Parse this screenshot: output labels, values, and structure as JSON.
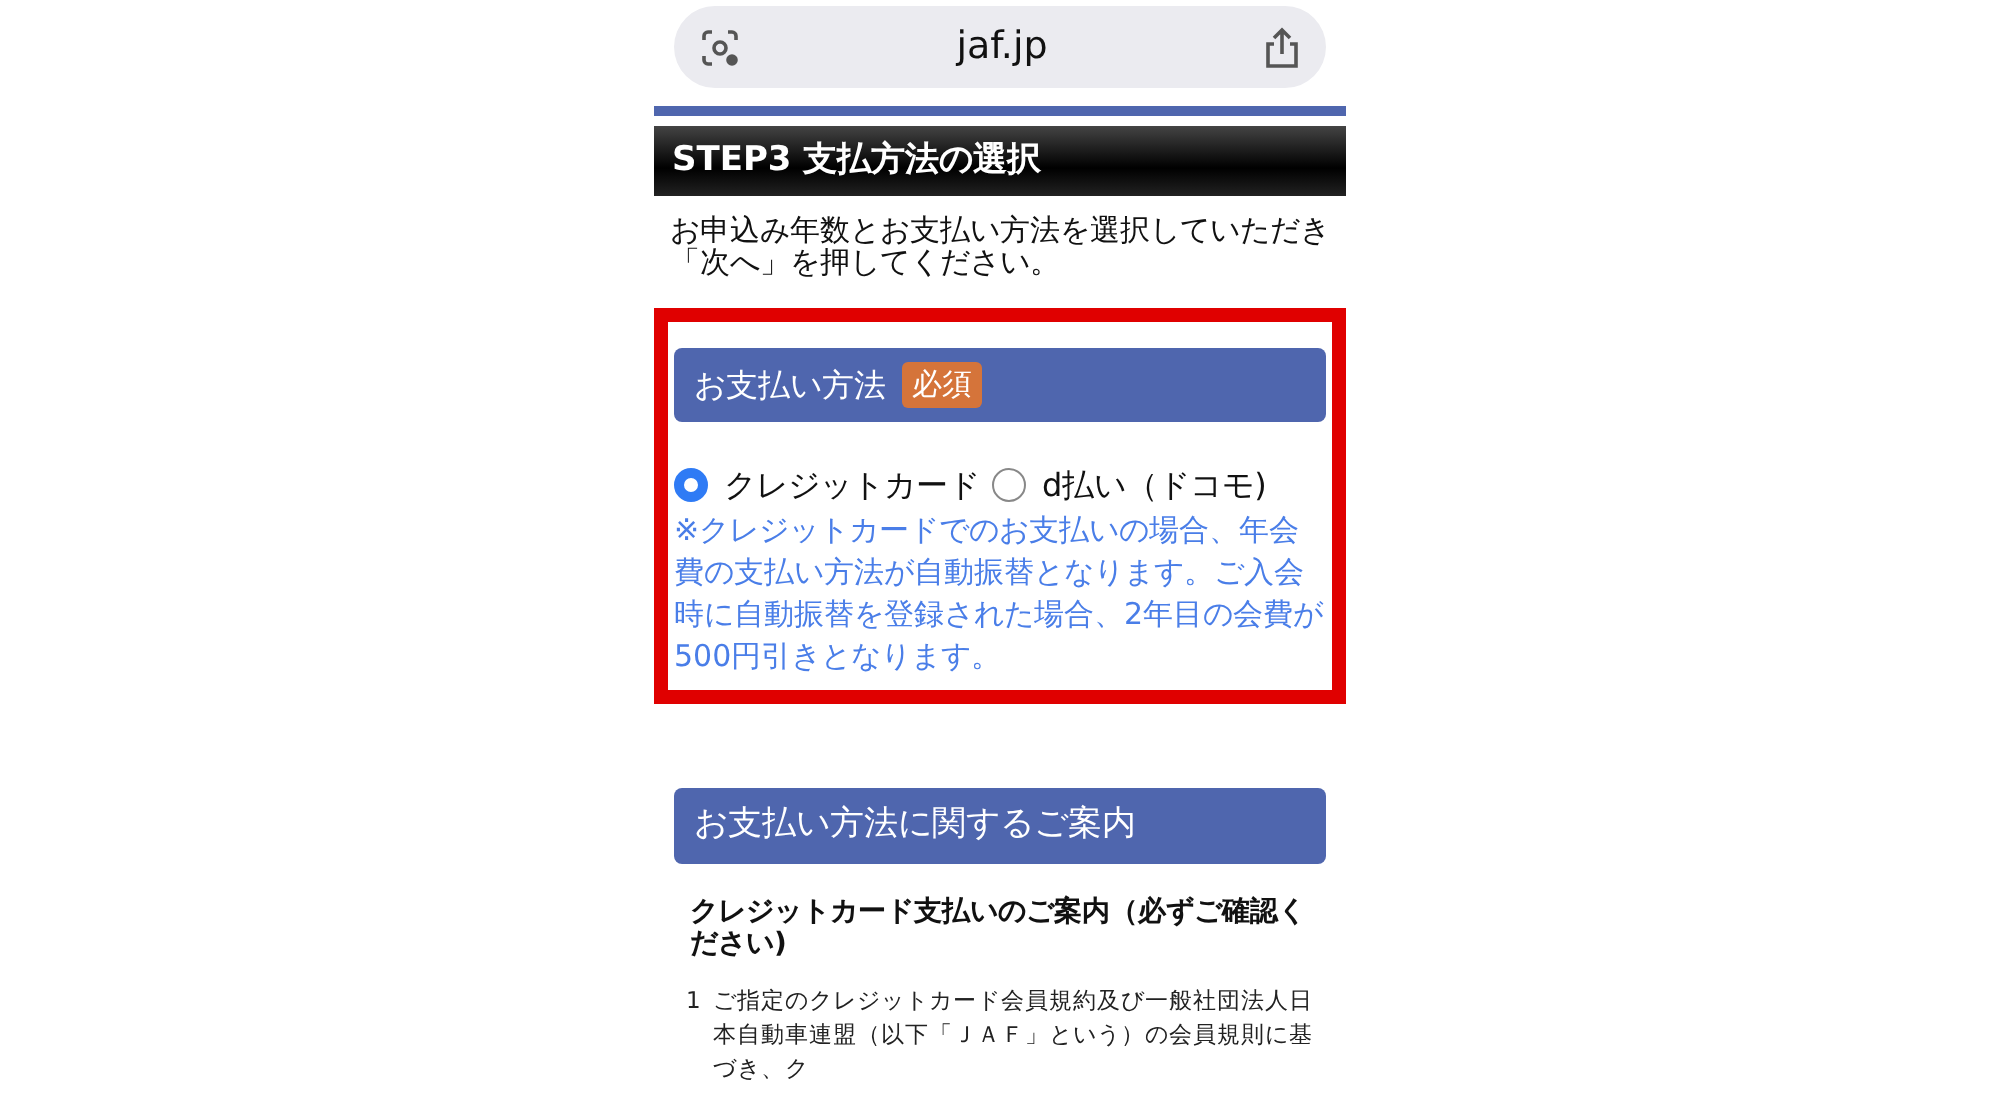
{
  "address_bar": {
    "url": "jaf.jp"
  },
  "step_title": "STEP3 支払方法の選択",
  "intro": "お申込み年数とお支払い方法を選択していただき「次へ」を押してください。",
  "payment_section": {
    "title": "お支払い方法",
    "badge": "必須",
    "options": [
      {
        "label": "クレジットカード",
        "selected": true
      },
      {
        "label": "d払い（ドコモ)",
        "selected": false
      }
    ],
    "note": "※クレジットカードでのお支払いの場合、年会費の支払い方法が自動振替となります。ご入会時に自動振替を登録された場合、2年目の会費が500円引きとなります。"
  },
  "guide_section": {
    "title": "お支払い方法に関するご案内",
    "subtitle": "クレジットカード支払いのご案内（必ずご確認ください)",
    "items": [
      {
        "number": "1",
        "text": "ご指定のクレジットカード会員規約及び一般社団法人日本自動車連盟（以下「ＪＡＦ」という）の会員規則に基づき、ク"
      }
    ]
  }
}
